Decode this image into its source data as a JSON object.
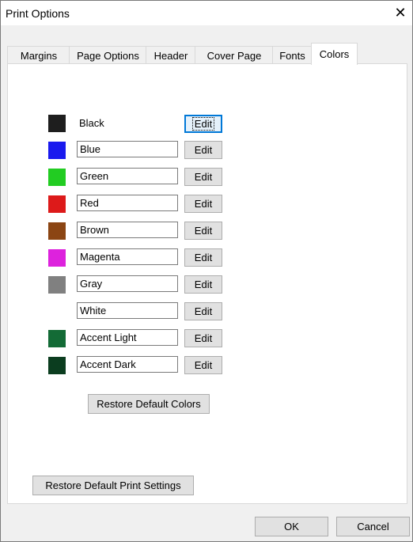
{
  "window": {
    "title": "Print Options"
  },
  "tabs": [
    {
      "label": "Margins"
    },
    {
      "label": "Page Options"
    },
    {
      "label": "Header"
    },
    {
      "label": "Cover Page"
    },
    {
      "label": "Fonts"
    },
    {
      "label": "Colors"
    }
  ],
  "colors": [
    {
      "name": "Black",
      "swatch": "#1e1e1e",
      "edit": "Edit"
    },
    {
      "name": "Blue",
      "swatch": "#1a1aee",
      "edit": "Edit"
    },
    {
      "name": "Green",
      "swatch": "#22cc22",
      "edit": "Edit"
    },
    {
      "name": "Red",
      "swatch": "#dd1a1a",
      "edit": "Edit"
    },
    {
      "name": "Brown",
      "swatch": "#8b4513",
      "edit": "Edit"
    },
    {
      "name": "Magenta",
      "swatch": "#dd22dd",
      "edit": "Edit"
    },
    {
      "name": "Gray",
      "swatch": "#808080",
      "edit": "Edit"
    },
    {
      "name": "White",
      "swatch": "#ffffff",
      "edit": "Edit"
    },
    {
      "name": "Accent Light",
      "swatch": "#136b36",
      "edit": "Edit"
    },
    {
      "name": "Accent Dark",
      "swatch": "#0b3d1f",
      "edit": "Edit"
    }
  ],
  "buttons": {
    "restore_colors": "Restore Default Colors",
    "restore_print": "Restore Default Print Settings",
    "ok": "OK",
    "cancel": "Cancel"
  }
}
